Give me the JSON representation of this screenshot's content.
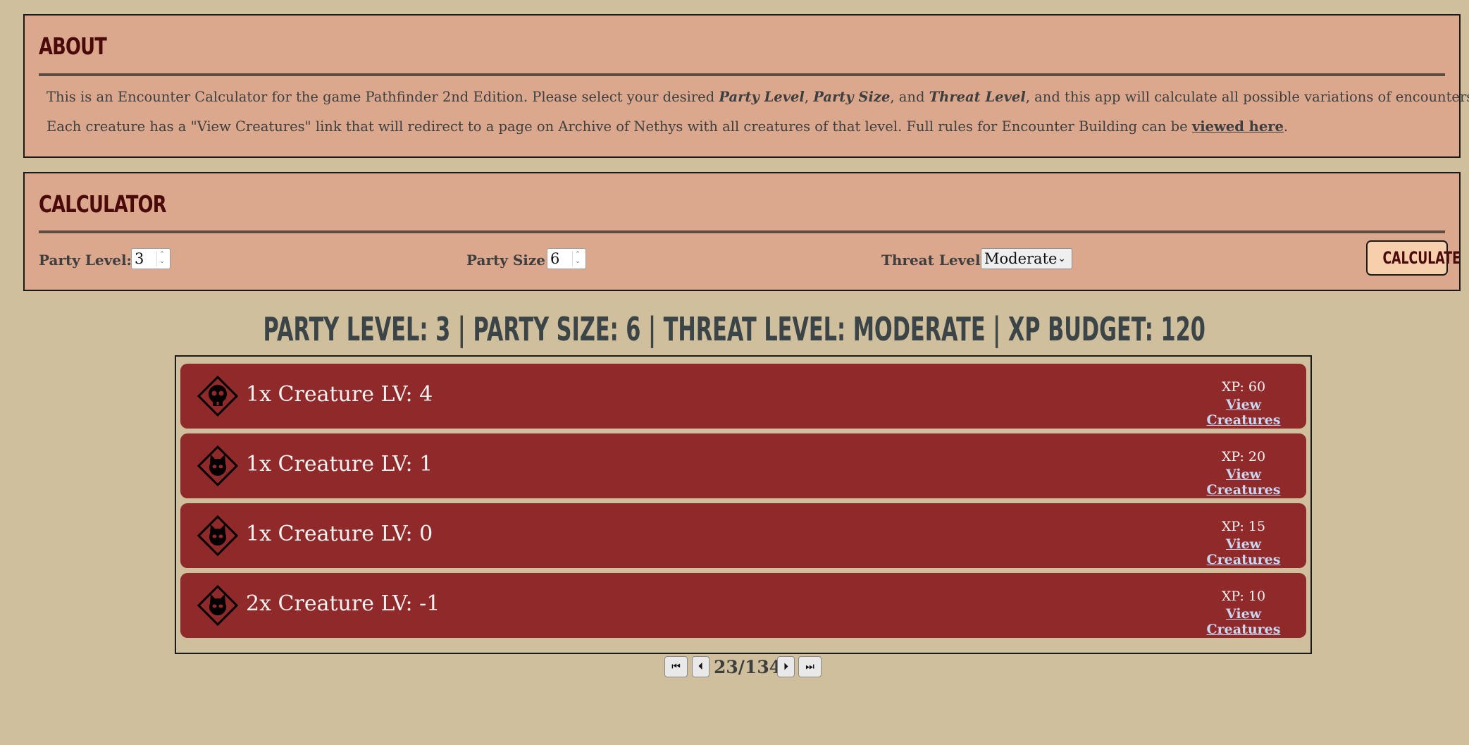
{
  "about": {
    "title": "About",
    "line1_pre": "This is an Encounter Calculator for the game Pathfinder 2nd Edition. Please select your desired ",
    "party_level_term": "Party Level",
    "comma1": ", ",
    "party_size_term": "Party Size",
    "and_text": ", and ",
    "threat_level_term": "Threat Level",
    "line1_post": ", and this app will calculate all possible variations of encounters.",
    "line2_pre": "Each creature has a \"View Creatures\" link that will redirect to a page on Archive of Nethys with all creatures of that level. Full rules for Encounter Building can be ",
    "line2_link": "viewed here",
    "line2_post": "."
  },
  "calculator": {
    "title": "Calculator",
    "party_level_label": "Party Level:",
    "party_level_value": "3",
    "party_size_label": "Party Size:",
    "party_size_value": "6",
    "threat_level_label": "Threat Level:",
    "threat_level_value": "Moderate",
    "calculate_label": "Calculate"
  },
  "summary": "PARTY LEVEL: 3 | PARTY SIZE: 6 | THREAT LEVEL: MODERATE | XP BUDGET: 120",
  "results": [
    {
      "title": "1x Creature LV: 4",
      "xp": "XP: 60",
      "link": "View Creatures",
      "icon": "skull-diamond-icon"
    },
    {
      "title": "1x Creature LV: 1",
      "xp": "XP: 20",
      "link": "View Creatures",
      "icon": "cat-face-diamond-icon"
    },
    {
      "title": "1x Creature LV: 0",
      "xp": "XP: 15",
      "link": "View Creatures",
      "icon": "cat-face-diamond-icon"
    },
    {
      "title": "2x Creature LV: -1",
      "xp": "XP: 10",
      "link": "View Creatures",
      "icon": "cat-face-diamond-icon"
    }
  ],
  "pager": {
    "indicator": "23/134",
    "first_icon": "first-page-icon",
    "prev_icon": "previous-page-icon",
    "next_icon": "next-page-icon",
    "last_icon": "last-page-icon"
  },
  "colors": {
    "background": "#d0bf9d",
    "panel": "#dba88e",
    "row": "#902a2a",
    "heading": "#4b0a0a",
    "link": "#c8d8f2"
  }
}
